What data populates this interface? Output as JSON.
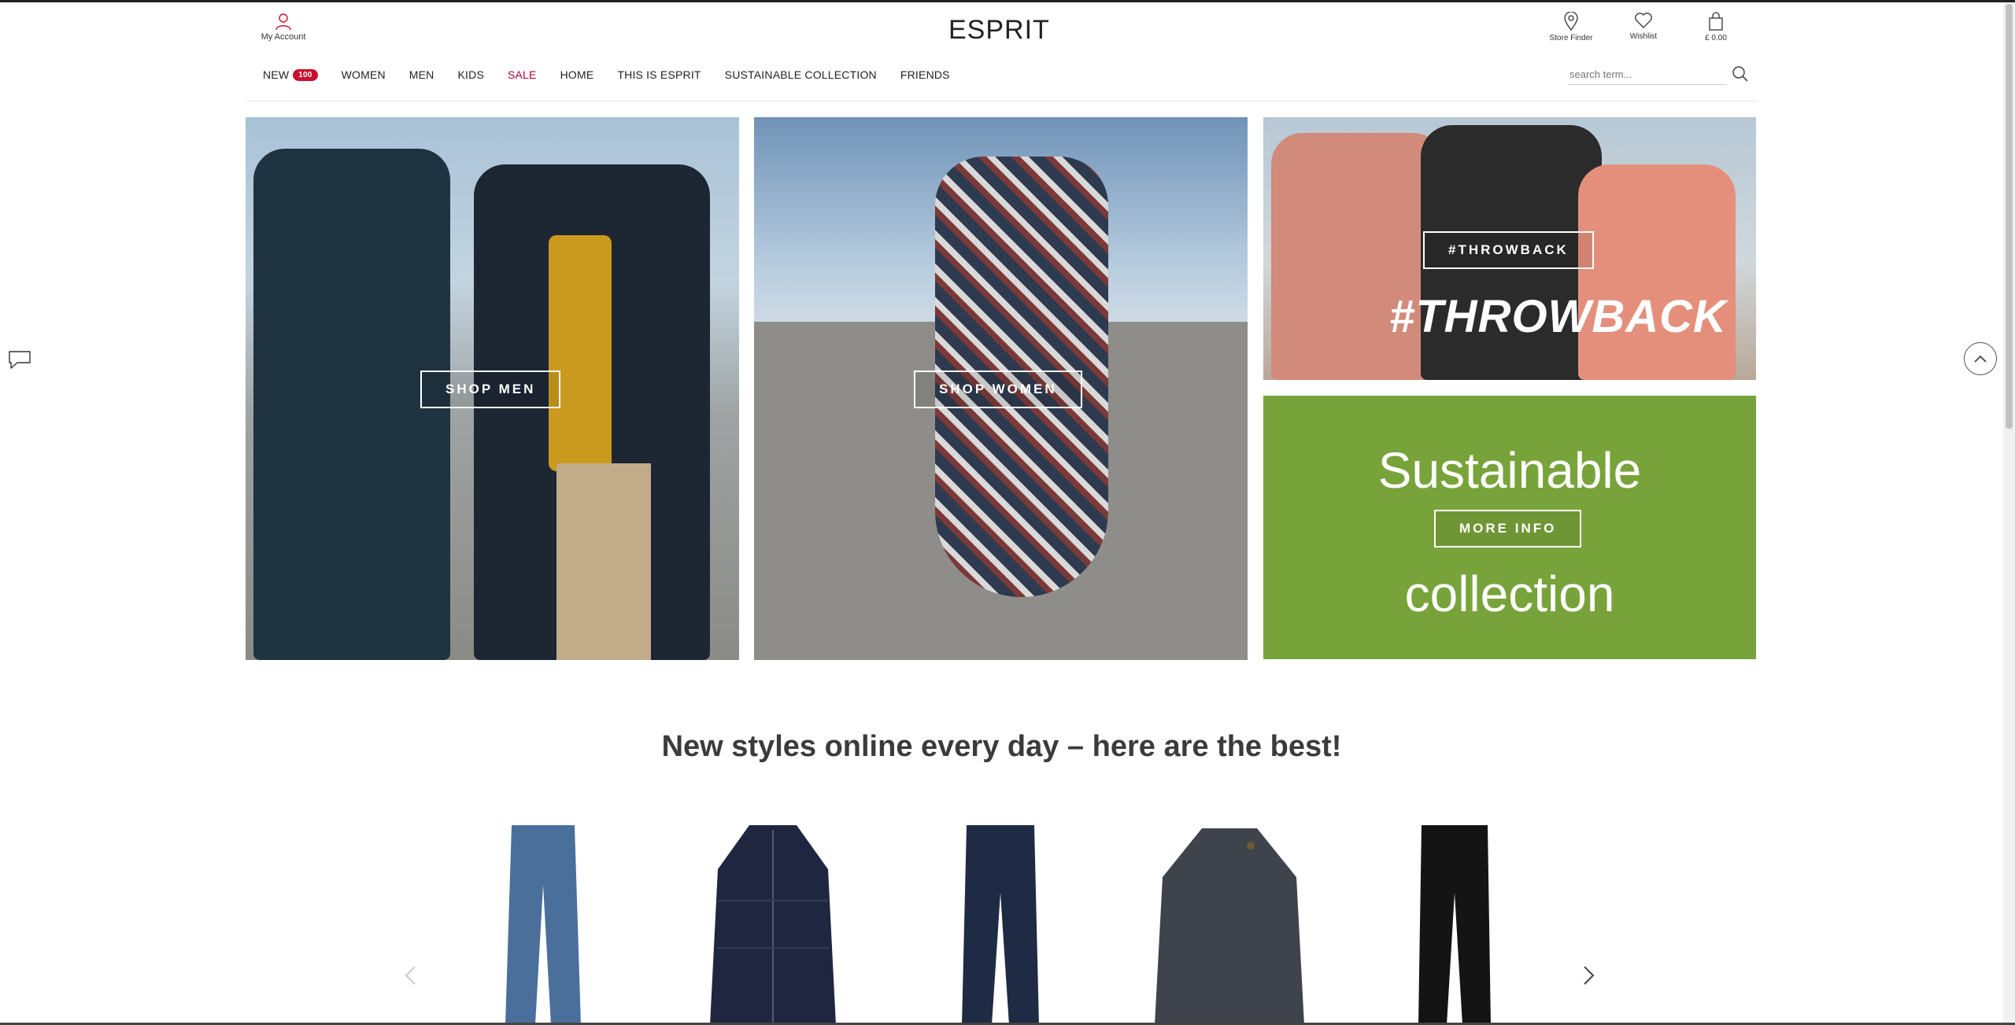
{
  "header": {
    "brand": "ESPRIT",
    "account_label": "My Account",
    "utilities": [
      {
        "label": "Store Finder",
        "icon": "location-pin-icon"
      },
      {
        "label": "Wishlist",
        "icon": "heart-icon"
      },
      {
        "label": "£ 0.00",
        "icon": "shopping-bag-icon"
      }
    ],
    "search_placeholder": "search term..."
  },
  "nav": {
    "items": [
      {
        "label": "NEW",
        "badge": "100"
      },
      {
        "label": "WOMEN"
      },
      {
        "label": "MEN"
      },
      {
        "label": "KIDS"
      },
      {
        "label": "SALE",
        "color": "#b3003c"
      },
      {
        "label": "HOME"
      },
      {
        "label": "THIS IS ESPRIT"
      },
      {
        "label": "SUSTAINABLE COLLECTION"
      },
      {
        "label": "FRIENDS"
      }
    ]
  },
  "hero": {
    "men_button": "SHOP MEN",
    "women_button": "SHOP WOMEN",
    "throwback_button": "#THROWBACK",
    "throwback_headline": "#THROWBACK",
    "sustainable_top": "Sustainable",
    "sustainable_button": "MORE INFO",
    "sustainable_bottom": "collection",
    "sustainable_color": "#78a33a"
  },
  "products_section": {
    "title": "New styles online every day – here are the best!",
    "items": [
      {
        "type": "light-blue-jeans",
        "color": "#4a6f9a"
      },
      {
        "type": "navy-puffer-jacket",
        "color": "#1f2640"
      },
      {
        "type": "dark-denim-jeans",
        "color": "#1f2b45"
      },
      {
        "type": "grey-knit-hoodie",
        "color": "#3f434b"
      },
      {
        "type": "black-jeans",
        "color": "#141414"
      }
    ]
  }
}
